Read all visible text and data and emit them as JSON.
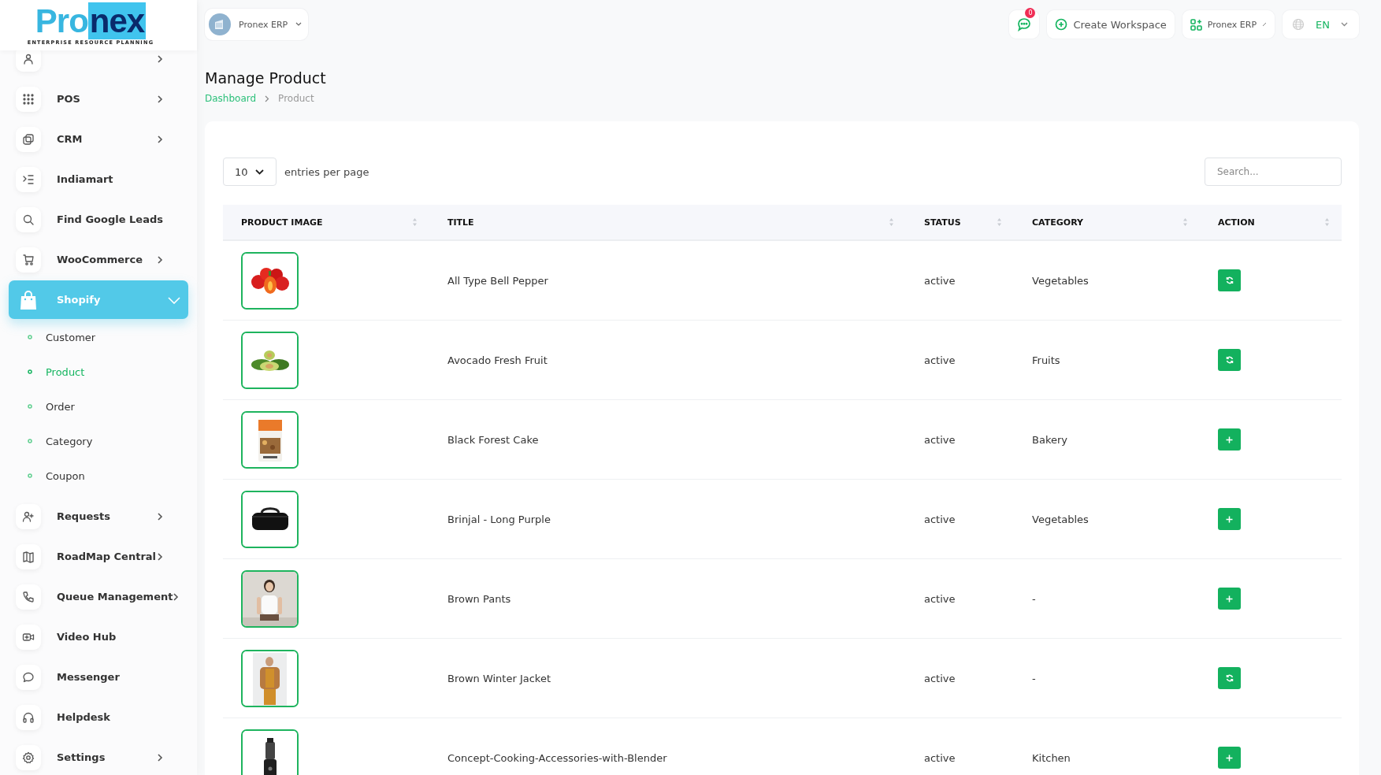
{
  "logo": {
    "part_1": "Pro",
    "part_2": "nex",
    "tagline": "ENTERPRISE RESOURCE PLANNING"
  },
  "header": {
    "workspace": "Pronex ERP",
    "message_count": "0",
    "create_button": "Create Workspace",
    "app_switch": "Pronex ERP",
    "language": "EN"
  },
  "sidebar": {
    "items": [
      {
        "expandable": true,
        "selected": false
      },
      {
        "label": "POS",
        "expandable": true,
        "selected": false
      },
      {
        "label": "CRM",
        "expandable": true,
        "selected": false
      },
      {
        "label": "Indiamart",
        "expandable": false,
        "selected": false
      },
      {
        "label": "Find Google Leads",
        "expandable": false,
        "selected": false
      },
      {
        "label": "WooCommerce",
        "expandable": true,
        "selected": false
      },
      {
        "label": "Shopify",
        "expandable": true,
        "expanded": true,
        "selected": true,
        "children": [
          {
            "label": "Customer",
            "selected": false
          },
          {
            "label": "Product",
            "selected": true
          },
          {
            "label": "Order",
            "selected": false
          },
          {
            "label": "Category",
            "selected": false
          },
          {
            "label": "Coupon",
            "selected": false
          }
        ]
      },
      {
        "label": "Requests",
        "expandable": true,
        "selected": false
      },
      {
        "label": "RoadMap Central",
        "expandable": true,
        "selected": false
      },
      {
        "label": "Queue Management",
        "expandable": true,
        "selected": false
      },
      {
        "label": "Video Hub",
        "expandable": false,
        "selected": false
      },
      {
        "label": "Messenger",
        "expandable": false,
        "selected": false
      },
      {
        "label": "Helpdesk",
        "expandable": false,
        "selected": false
      },
      {
        "label": "Settings",
        "expandable": true,
        "selected": false
      }
    ]
  },
  "page": {
    "title": "Manage Product",
    "breadcrumb": [
      {
        "label": "Dashboard",
        "kind": "link"
      },
      {
        "label": "Product",
        "kind": "current"
      }
    ]
  },
  "table": {
    "page_size": "10",
    "entries_label": "entries per page",
    "search": {
      "placeholder": "Search..."
    },
    "columns": [
      "PRODUCT IMAGE",
      "TITLE",
      "STATUS",
      "CATEGORY",
      "ACTION"
    ],
    "rows": [
      {
        "title": "All Type Bell Pepper",
        "status": "active",
        "category": "Vegetables",
        "action": {
          "kind": "sync"
        }
      },
      {
        "title": "Avocado Fresh Fruit",
        "status": "active",
        "category": "Fruits",
        "action": {
          "kind": "sync"
        }
      },
      {
        "title": "Black Forest Cake",
        "status": "active",
        "category": "Bakery",
        "action": {
          "kind": "add"
        }
      },
      {
        "title": "Brinjal - Long Purple",
        "status": "active",
        "category": "Vegetables",
        "action": {
          "kind": "add"
        }
      },
      {
        "title": "Brown Pants",
        "status": "active",
        "category": "-",
        "action": {
          "kind": "add"
        }
      },
      {
        "title": "Brown Winter Jacket",
        "status": "active",
        "category": "-",
        "action": {
          "kind": "sync"
        }
      },
      {
        "title": "Concept-Cooking-Accessories-with-Blender",
        "status": "active",
        "category": "Kitchen",
        "action": {
          "kind": "add"
        }
      }
    ]
  }
}
